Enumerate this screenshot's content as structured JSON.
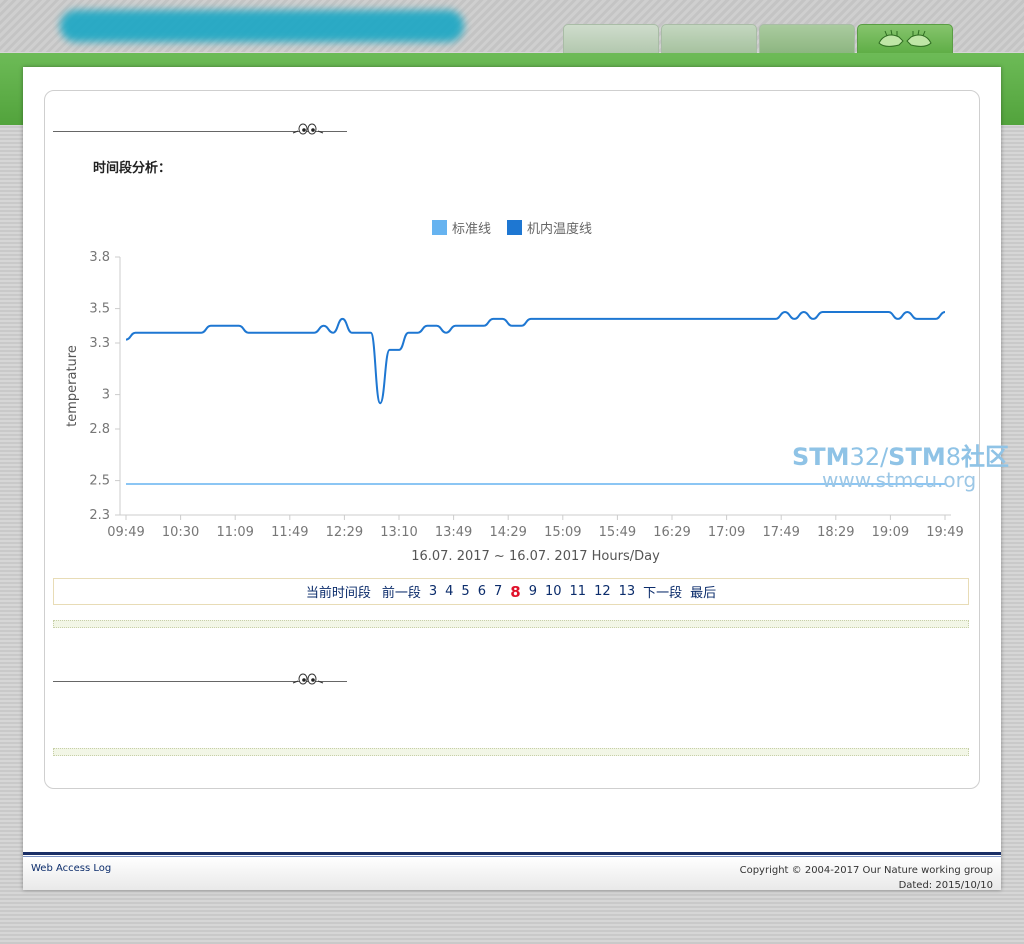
{
  "tabs": [
    {
      "label": ""
    },
    {
      "label": ""
    },
    {
      "label": ""
    },
    {
      "label": ""
    }
  ],
  "section": {
    "title": "时间段分析："
  },
  "legend": [
    {
      "label": "标准线",
      "color": "#66b3f0"
    },
    {
      "label": "机内温度线",
      "color": "#1e77d2"
    }
  ],
  "chart_data": {
    "type": "line",
    "xlabel": "16.07. 2017 ~ 16.07. 2017 Hours/Day",
    "ylabel": "temperature",
    "ylim": [
      2.3,
      3.8
    ],
    "yticks": [
      "3.8",
      "3.5",
      "3.3",
      "3",
      "2.8",
      "2.5",
      "2.3"
    ],
    "ytick_values": [
      3.8,
      3.5,
      3.3,
      3.0,
      2.8,
      2.5,
      2.3
    ],
    "x_tick_labels": [
      "09:49",
      "10:30",
      "11:09",
      "11:49",
      "12:29",
      "13:10",
      "13:49",
      "14:29",
      "15:09",
      "15:49",
      "16:29",
      "17:09",
      "17:49",
      "18:29",
      "19:09",
      "19:49"
    ],
    "series": [
      {
        "name": "标准线",
        "color": "#66b3f0",
        "values": [
          2.48,
          2.48,
          2.48,
          2.48,
          2.48,
          2.48,
          2.48,
          2.48,
          2.48,
          2.48,
          2.48,
          2.48,
          2.48,
          2.48,
          2.48,
          2.48
        ]
      },
      {
        "name": "机内温度线",
        "color": "#1e77d2",
        "values": [
          3.32,
          3.36,
          3.36,
          3.36,
          3.36,
          3.36,
          3.36,
          3.36,
          3.36,
          3.4,
          3.4,
          3.4,
          3.4,
          3.36,
          3.36,
          3.36,
          3.36,
          3.36,
          3.36,
          3.36,
          3.36,
          3.4,
          3.36,
          3.44,
          3.36,
          3.36,
          3.36,
          2.95,
          3.26,
          3.26,
          3.36,
          3.36,
          3.4,
          3.4,
          3.36,
          3.4,
          3.4,
          3.4,
          3.4,
          3.44,
          3.44,
          3.4,
          3.4,
          3.44,
          3.44,
          3.44,
          3.44,
          3.44,
          3.44,
          3.44,
          3.44,
          3.44,
          3.44,
          3.44,
          3.44,
          3.44,
          3.44,
          3.44,
          3.44,
          3.44,
          3.44,
          3.44,
          3.44,
          3.44,
          3.44,
          3.44,
          3.44,
          3.44,
          3.44,
          3.44,
          3.48,
          3.44,
          3.48,
          3.44,
          3.48,
          3.48,
          3.48,
          3.48,
          3.48,
          3.48,
          3.48,
          3.48,
          3.44,
          3.48,
          3.44,
          3.44,
          3.44,
          3.48
        ]
      }
    ]
  },
  "pager": {
    "current_segment": "当前时间段",
    "prev": "前一段",
    "pages": [
      "3",
      "4",
      "5",
      "6",
      "7",
      "8",
      "9",
      "10",
      "11",
      "12",
      "13"
    ],
    "current_page": "8",
    "next": "下一段",
    "last": "最后"
  },
  "watermark": {
    "brand_a": "STM",
    "brand_b": "32/",
    "brand_c": "STM",
    "brand_d": "8",
    "brand_e": "社区",
    "url": "www.stmcu.org"
  },
  "footer": {
    "left": "Web Access Log",
    "copyright": "Copyright © 2004-2017 Our Nature working group",
    "dated": "Dated: 2015/10/10"
  },
  "colors": {
    "accent_green": "#5fae46",
    "link": "#0b2c6b",
    "current_page": "#e0122b"
  }
}
